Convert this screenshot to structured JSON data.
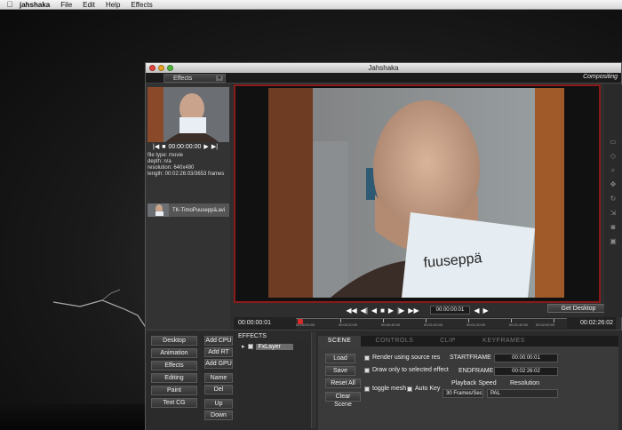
{
  "menubar": {
    "app": "jahshaka",
    "items": [
      "File",
      "Edit",
      "Help",
      "Effects"
    ]
  },
  "window": {
    "title": "Jahshaka",
    "effects_tab": "Effects",
    "mode": "Compositing"
  },
  "media": {
    "timecode": "00:00:00:00",
    "info": [
      "file type: movie",
      "depth: n/a",
      "resolution: 640x480",
      "length: 00:02:26:03/3653 frames"
    ],
    "clip_name": "TK-TimoPuuseppä.avi"
  },
  "transport": {
    "current": "00:00:00:01",
    "get_desktop": "Get Desktop",
    "start_tc": "00:00:00:01",
    "end_tc": "00:02:26:02",
    "ruler": [
      "00:00:00:00",
      "00:00:20:00",
      "00:00:40:00",
      "00:01:00:00",
      "00:01:20:00",
      "00:01:40:00",
      "00:02:00:00"
    ]
  },
  "modules": [
    "Desktop",
    "Animation",
    "Effects",
    "Editing",
    "Paint",
    "Text CG"
  ],
  "add_buttons": [
    "Add CPU",
    "Add RT",
    "Add GPU",
    "Name",
    "Del",
    "Up",
    "Down"
  ],
  "effects_panel": {
    "header": "EFFECTS",
    "layer": "FxLayer"
  },
  "tabs": [
    "SCENE",
    "CONTROLS",
    "CLIP",
    "KEYFRAMES"
  ],
  "scene": {
    "load": "Load",
    "save": "Save",
    "reset_all": "Reset All",
    "clear_scene": "Clear Scene",
    "render_src": "Render using source res",
    "draw_only": "Draw only to selected effect",
    "toggle_mesh": "toggle mesh",
    "auto_key": "Auto Key",
    "startframe_label": "STARTFRAME",
    "startframe": "00:00:00:01",
    "endframe_label": "ENDFRAME",
    "endframe": "00:02:26:02",
    "playback_label": "Playback Speed",
    "playback": "30 Frames/Sec",
    "resolution_label": "Resolution",
    "resolution": "PAL"
  }
}
